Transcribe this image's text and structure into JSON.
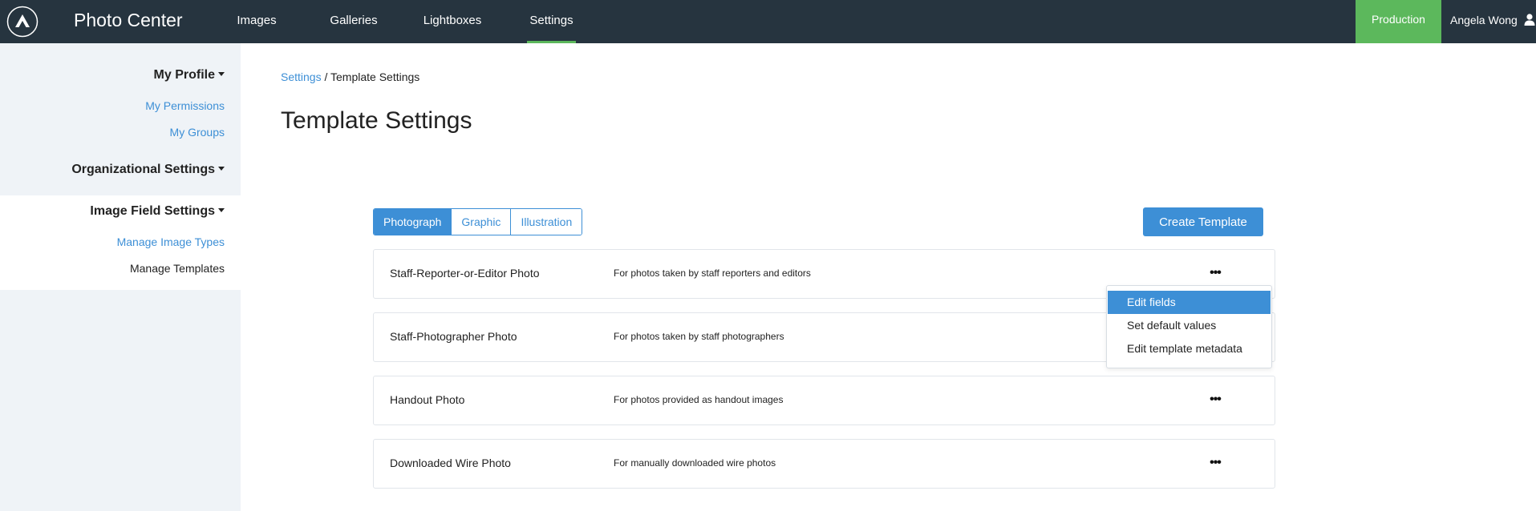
{
  "app": {
    "title": "Photo Center"
  },
  "nav": {
    "items": [
      {
        "label": "Images"
      },
      {
        "label": "Galleries"
      },
      {
        "label": "Lightboxes"
      },
      {
        "label": "Settings",
        "active": true
      }
    ]
  },
  "header": {
    "environment": "Production",
    "user_name": "Angela Wong"
  },
  "sidebar": {
    "sections": [
      {
        "heading": "My Profile",
        "links": [
          "My Permissions",
          "My Groups"
        ]
      },
      {
        "heading": "Organizational Settings",
        "links": []
      },
      {
        "heading": "Image Field Settings",
        "links": [
          "Manage Image Types",
          "Manage Templates"
        ],
        "current_link": "Manage Templates"
      }
    ]
  },
  "breadcrumb": {
    "parent": "Settings",
    "separator": "/",
    "current": "Template Settings"
  },
  "page": {
    "title": "Template Settings"
  },
  "tabs": [
    {
      "label": "Photograph",
      "active": true
    },
    {
      "label": "Graphic"
    },
    {
      "label": "Illustration"
    }
  ],
  "toolbar": {
    "create_label": "Create Template"
  },
  "templates": [
    {
      "name": "Staff-Reporter-or-Editor Photo",
      "description": "For photos taken by staff reporters and editors"
    },
    {
      "name": "Staff-Photographer Photo",
      "description": "For photos taken by staff photographers"
    },
    {
      "name": "Handout Photo",
      "description": "For photos provided as handout images"
    },
    {
      "name": "Downloaded Wire Photo",
      "description": "For manually downloaded wire photos"
    }
  ],
  "more_icon": "•••",
  "dropdown": {
    "items": [
      {
        "label": "Edit fields",
        "highlighted": true
      },
      {
        "label": "Set default values"
      },
      {
        "label": "Edit template metadata"
      }
    ]
  },
  "colors": {
    "topbar": "#26343f",
    "accent": "#3d8fd6",
    "environment": "#5cb85c",
    "sidebar": "#eff3f7"
  }
}
